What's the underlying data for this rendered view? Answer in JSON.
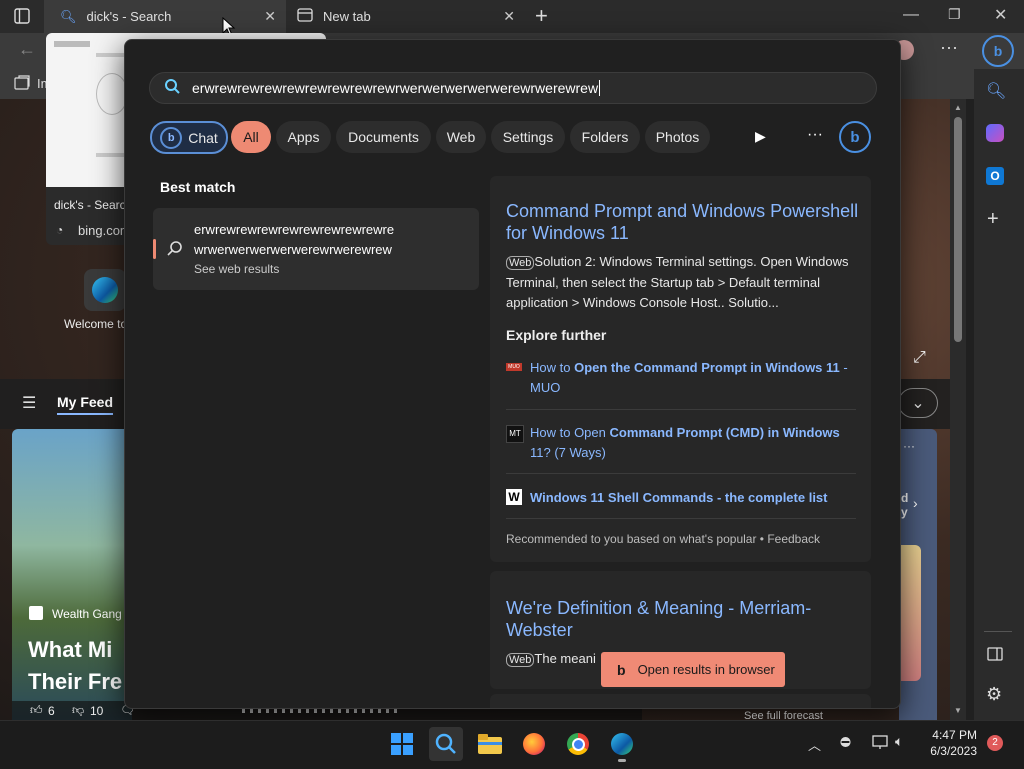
{
  "browser": {
    "tabs": [
      {
        "title": "dick's - Search"
      },
      {
        "title": "New tab"
      }
    ],
    "new_tab_symbol": "+",
    "fav_partial": "Im",
    "tab_preview": {
      "title": "dick's - Search",
      "url": "bing.com"
    }
  },
  "page": {
    "welcome": "Welcome to",
    "feed_label": "My Feed",
    "article_source": "Wealth Gang",
    "article_title_line1": "What Mi",
    "article_title_line2": "Their Fre",
    "likes": "6",
    "dislikes": "10",
    "side_card_line1": "d",
    "side_card_line2": "y",
    "see_forecast": "See full forecast"
  },
  "search": {
    "query": "erwrewrewrewrewrewrewrewrewrwerwerwerwerwerewrwerewrew",
    "chips": [
      "Chat",
      "All",
      "Apps",
      "Documents",
      "Web",
      "Settings",
      "Folders",
      "Photos"
    ],
    "best_match_label": "Best match",
    "best_match": {
      "line1": "erwrewrewrewrewrewrewrewrewre",
      "line2": "wrwerwerwerwerwerewrwerewrew",
      "sub": "See web results"
    },
    "result1": {
      "title": "Command Prompt and Windows Powershell for Windows 11",
      "badge": "Web",
      "snippet": "Solution 2: Windows Terminal settings. Open Windows Terminal, then select the Startup tab > Default terminal application > Windows Console Host.. Solutio...",
      "explore_label": "Explore further",
      "explore": [
        {
          "icon_label": "MUO",
          "pre": "How to ",
          "bold": "Open the Command Prompt in Windows 11",
          "post": " - MUO"
        },
        {
          "icon_label": "MT",
          "pre": "How to Open ",
          "bold": "Command Prompt (CMD) in Windows",
          "post": " 11? (7 Ways)"
        },
        {
          "icon_label": "W",
          "pre": "",
          "bold": "Windows 11 Shell Commands - the complete list",
          "post": ""
        }
      ],
      "recommended": "Recommended to you based on what's popular • Feedback"
    },
    "result2": {
      "title": "We're Definition & Meaning - Merriam-Webster",
      "badge": "Web",
      "snippet": "The meani"
    },
    "open_results": "Open results in browser"
  },
  "taskbar": {
    "time": "4:47 PM",
    "date": "6/3/2023",
    "notifications": "2"
  },
  "colors": {
    "accent_chip": "#ee8a73",
    "link": "#8ab8ff",
    "open_button": "#f08a75"
  }
}
